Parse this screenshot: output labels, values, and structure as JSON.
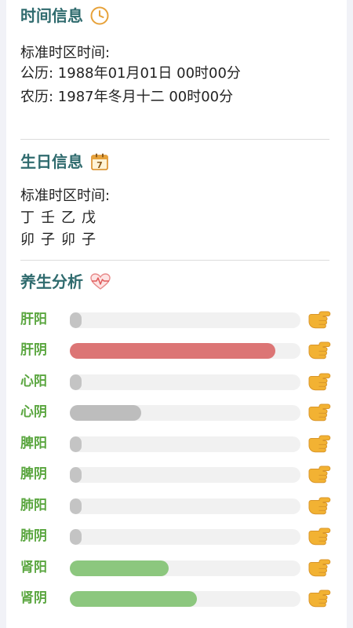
{
  "time_section": {
    "title": "时间信息",
    "line1": "标准时区时间:",
    "line2": "公历: 1988年01月01日 00时00分",
    "line3": "农历: 1987年冬月十二 00时00分"
  },
  "birthday_section": {
    "title": "生日信息",
    "calendar_day": "7",
    "line1": "标准时区时间:",
    "stems": [
      "丁",
      "壬",
      "乙",
      "戊"
    ],
    "branches": [
      "卯",
      "子",
      "卯",
      "子"
    ]
  },
  "health_section": {
    "title": "养生分析",
    "rows": [
      {
        "label": "肝阳",
        "level": 0.05,
        "color": "#c4c4c4"
      },
      {
        "label": "肝阴",
        "level": 0.89,
        "color": "#dc7575"
      },
      {
        "label": "心阳",
        "level": 0.05,
        "color": "#c4c4c4"
      },
      {
        "label": "心阴",
        "level": 0.31,
        "color": "#bdbdbd"
      },
      {
        "label": "脾阳",
        "level": 0.05,
        "color": "#c4c4c4"
      },
      {
        "label": "脾阴",
        "level": 0.05,
        "color": "#c4c4c4"
      },
      {
        "label": "肺阳",
        "level": 0.05,
        "color": "#c4c4c4"
      },
      {
        "label": "肺阴",
        "level": 0.05,
        "color": "#c4c4c4"
      },
      {
        "label": "肾阳",
        "level": 0.43,
        "color": "#8cc77e"
      },
      {
        "label": "肾阴",
        "level": 0.55,
        "color": "#8cc77e"
      }
    ]
  },
  "colors": {
    "title": "#2f6b6e",
    "label": "#5aa63f",
    "clock_icon": "#e7a23a",
    "hand_icon": "#f2b233",
    "heart_icon": "#e88a8a"
  },
  "icons": {
    "time": "clock-icon",
    "birthday": "calendar-icon",
    "health": "heartbeat-icon",
    "row_action": "pointing-hand-icon"
  }
}
